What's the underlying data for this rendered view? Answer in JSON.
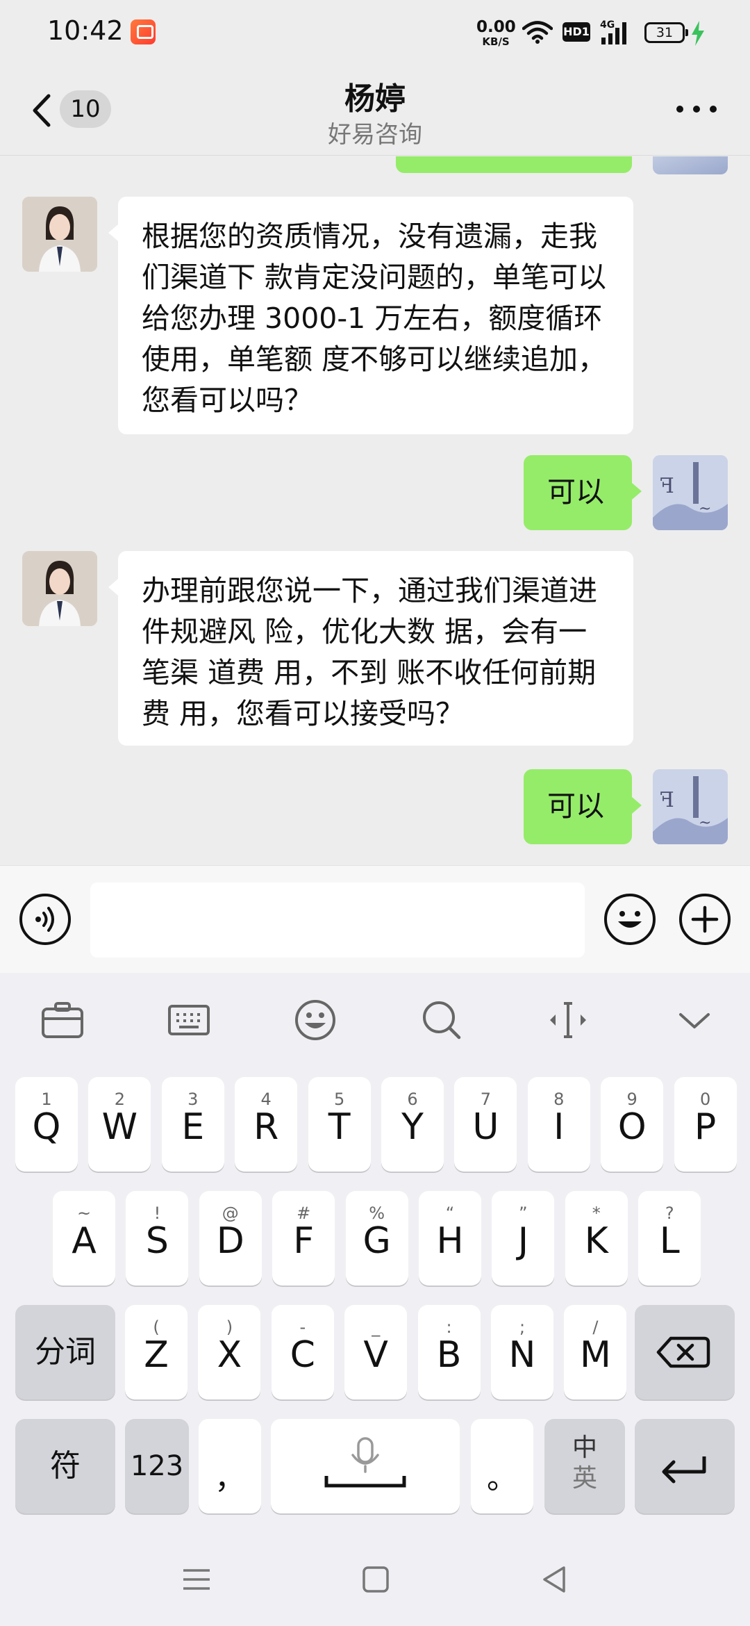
{
  "status_bar": {
    "time": "10:42",
    "net_speed_value": "0.00",
    "net_speed_unit": "KB/S",
    "hd_label": "HD1",
    "network_label": "4G",
    "battery_level": "31"
  },
  "header": {
    "back_label": "<",
    "unread_count": "10",
    "title": "杨婷",
    "subtitle": "好易咨询",
    "more_label": "···"
  },
  "messages": [
    {
      "sender": "contact",
      "text": "根据您的资质情况，没有遗漏，走我们渠道下 款肯定没问题的，单笔可以给您办理 3000-1 万左右，额度循环使用，单笔额 度不够可以继续追加，您看可以吗？"
    },
    {
      "sender": "me",
      "text": "可以"
    },
    {
      "sender": "contact",
      "text": "办理前跟您说一下，通过我们渠道进件规避风 险，优化大数 据，会有一笔渠 道费 用，不到 账不收任何前期费 用，您看可以接受吗？"
    },
    {
      "sender": "me",
      "text": "可以"
    }
  ],
  "input": {
    "value": "",
    "placeholder": ""
  },
  "keyboard": {
    "toolbar": [
      "clipboard-icon",
      "keyboard-icon",
      "emoji-icon",
      "search-icon",
      "cursor-icon",
      "collapse-icon"
    ],
    "row1": [
      {
        "main": "Q",
        "sub": "1"
      },
      {
        "main": "W",
        "sub": "2"
      },
      {
        "main": "E",
        "sub": "3"
      },
      {
        "main": "R",
        "sub": "4"
      },
      {
        "main": "T",
        "sub": "5"
      },
      {
        "main": "Y",
        "sub": "6"
      },
      {
        "main": "U",
        "sub": "7"
      },
      {
        "main": "I",
        "sub": "8"
      },
      {
        "main": "O",
        "sub": "9"
      },
      {
        "main": "P",
        "sub": "0"
      }
    ],
    "row2": [
      {
        "main": "A",
        "sub": "~"
      },
      {
        "main": "S",
        "sub": "!"
      },
      {
        "main": "D",
        "sub": "@"
      },
      {
        "main": "F",
        "sub": "#"
      },
      {
        "main": "G",
        "sub": "%"
      },
      {
        "main": "H",
        "sub": "“"
      },
      {
        "main": "J",
        "sub": "”"
      },
      {
        "main": "K",
        "sub": "*"
      },
      {
        "main": "L",
        "sub": "?"
      }
    ],
    "row3": [
      {
        "main": "Z",
        "sub": "("
      },
      {
        "main": "X",
        "sub": ")"
      },
      {
        "main": "C",
        "sub": "-"
      },
      {
        "main": "V",
        "sub": "_"
      },
      {
        "main": "B",
        "sub": ":"
      },
      {
        "main": "N",
        "sub": ";"
      },
      {
        "main": "M",
        "sub": "/"
      }
    ],
    "segment_label": "分词",
    "symbols_label": "符",
    "numbers_label": "123",
    "comma_label": "，",
    "period_label": "。",
    "lang_zh": "中",
    "lang_en": "英"
  },
  "colors": {
    "sent_bubble": "#95ec69",
    "received_bubble": "#ffffff",
    "background": "#ededed"
  }
}
